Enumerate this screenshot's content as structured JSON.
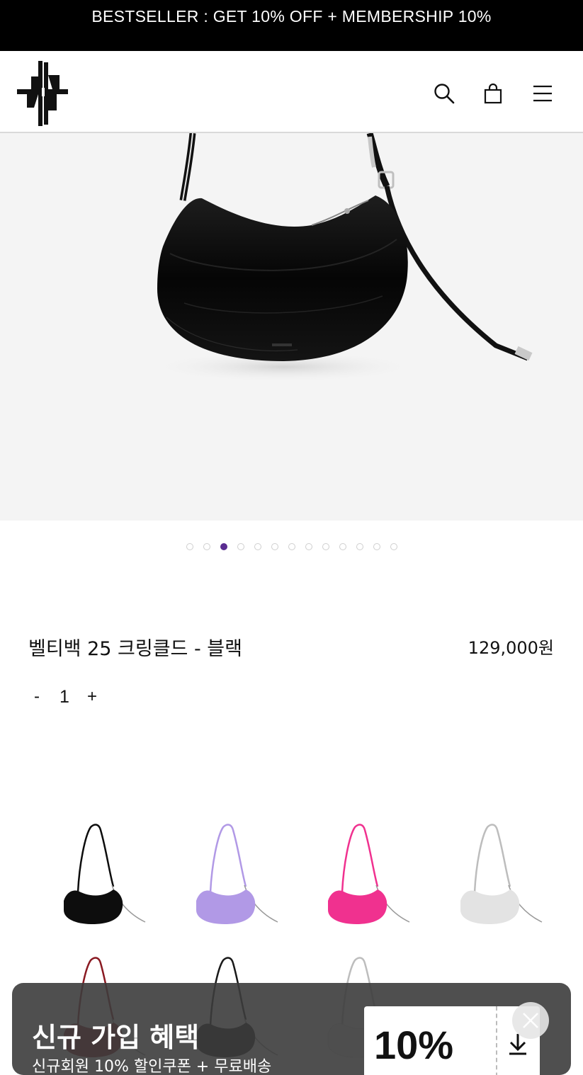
{
  "announcement": {
    "text": "BESTSELLER : GET 10% OFF + MEMBERSHIP 10%"
  },
  "header": {
    "logo": "brand-logo",
    "icons": [
      "search-icon",
      "shopping-bag-icon",
      "menu-icon"
    ]
  },
  "gallery": {
    "slide_count": 13,
    "active_index": 2,
    "active_color": "#5a2d91"
  },
  "product": {
    "name": "벨티백 25 크링클드 - 블랙",
    "price": "129,000원"
  },
  "quantity": {
    "minus_label": "-",
    "value": "1",
    "plus_label": "+"
  },
  "colors": {
    "swatches": [
      {
        "name": "black",
        "hex": "#0d0d0d"
      },
      {
        "name": "lavender",
        "hex": "#b199e6"
      },
      {
        "name": "pink",
        "hex": "#f0318f"
      },
      {
        "name": "silver",
        "hex": "#e3e3e3"
      },
      {
        "name": "red",
        "hex": "#8a1a22"
      },
      {
        "name": "black-2",
        "hex": "#1a1a1a"
      },
      {
        "name": "white",
        "hex": "#f4f4f4"
      }
    ]
  },
  "popup": {
    "title": "신규 가입 혜택",
    "subtitle": "신규회원 10% 할인쿠폰 + 무료배송",
    "coupon_value": "10%"
  }
}
